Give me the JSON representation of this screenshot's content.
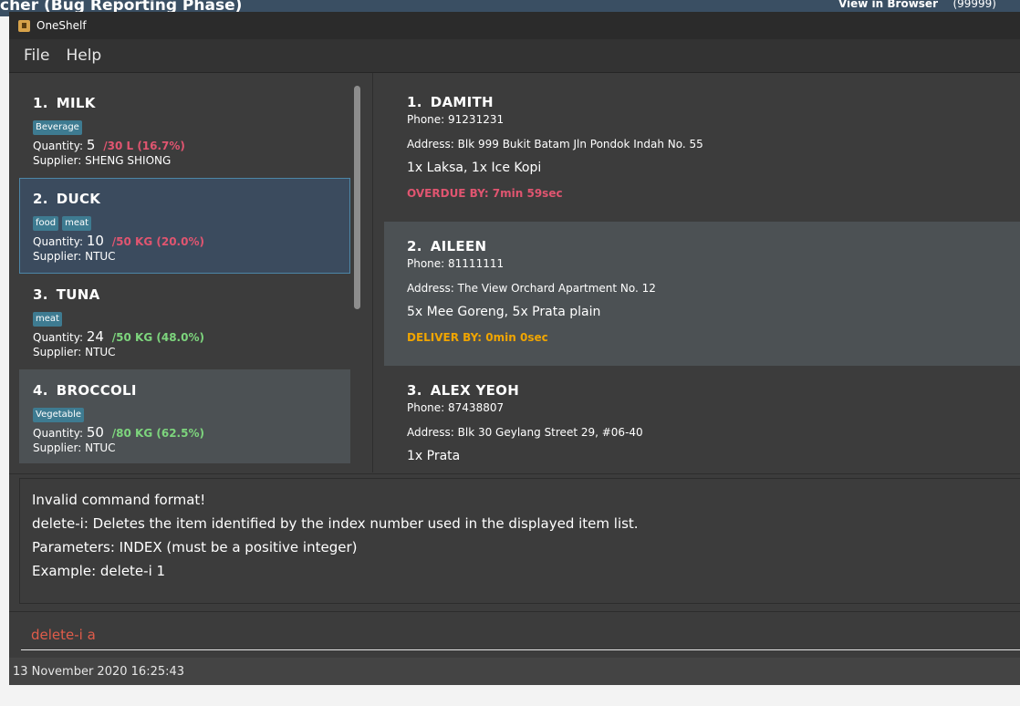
{
  "background_window": {
    "title_left": "cher (Bug Reporting Phase)",
    "title_right": "View in Browser",
    "title_right2": "(99999)"
  },
  "window": {
    "title": "OneShelf"
  },
  "menu": {
    "file": "File",
    "help": "Help"
  },
  "items": [
    {
      "index": "1.",
      "name": "MILK",
      "tags": [
        "Beverage"
      ],
      "quantity_label": "Quantity:",
      "quantity": "5",
      "ratio": "/30 L (16.7%)",
      "ratio_color": "#e05570",
      "supplier": "Supplier: SHENG SHIONG"
    },
    {
      "index": "2.",
      "name": "DUCK",
      "tags": [
        "food",
        "meat"
      ],
      "quantity_label": "Quantity:",
      "quantity": "10",
      "ratio": "/50 KG (20.0%)",
      "ratio_color": "#e05570",
      "supplier": "Supplier: NTUC"
    },
    {
      "index": "3.",
      "name": "TUNA",
      "tags": [
        "meat"
      ],
      "quantity_label": "Quantity:",
      "quantity": "24",
      "ratio": "/50 KG (48.0%)",
      "ratio_color": "#7dd57d",
      "supplier": "Supplier: NTUC"
    },
    {
      "index": "4.",
      "name": "BROCCOLI",
      "tags": [
        "Vegetable"
      ],
      "quantity_label": "Quantity:",
      "quantity": "50",
      "ratio": "/80 KG (62.5%)",
      "ratio_color": "#7dd57d",
      "supplier": "Supplier: NTUC"
    }
  ],
  "orders": [
    {
      "index": "1.",
      "name": "DAMITH",
      "phone": "Phone: 91231231",
      "address": "Address: Blk 999 Bukit Batam Jln Pondok Indah No. 55",
      "items": "1x Laksa, 1x Ice Kopi",
      "status": "OVERDUE BY: 7min 59sec",
      "status_color": "#e05570"
    },
    {
      "index": "2.",
      "name": "AILEEN",
      "phone": "Phone: 81111111",
      "address": "Address: The View Orchard Apartment No. 12",
      "items": "5x Mee Goreng, 5x Prata plain",
      "status": "DELIVER BY: 0min 0sec",
      "status_color": "#f0a500"
    },
    {
      "index": "3.",
      "name": "ALEX YEOH",
      "phone": "Phone: 87438807",
      "address": "Address: Blk 30 Geylang Street 29, #06-40",
      "items": "1x Prata",
      "status": "",
      "status_color": "#f0a500"
    }
  ],
  "result": {
    "lines": [
      "Invalid command format!",
      "delete-i: Deletes the item identified by the index number used in the displayed item list.",
      "Parameters: INDEX (must be a positive integer)",
      "Example: delete-i 1"
    ]
  },
  "command": {
    "value": "delete-i a"
  },
  "status_bar": {
    "datetime": "13 November 2020 16:25:43"
  }
}
